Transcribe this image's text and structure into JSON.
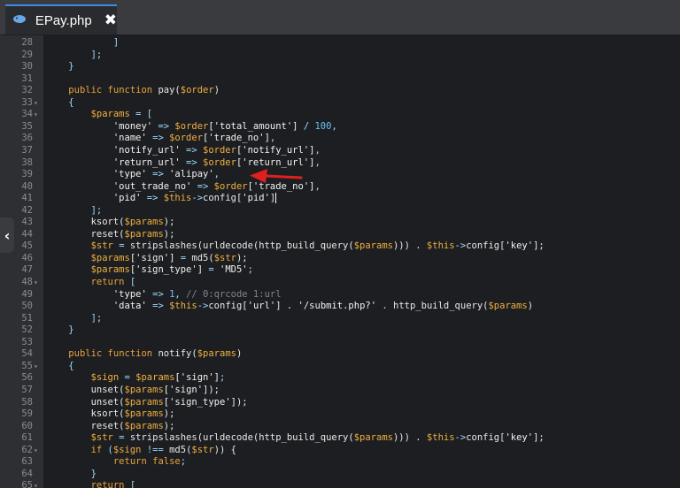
{
  "tab": {
    "title": "EPay.php",
    "icon": "php-elephant-icon",
    "close_glyph": "✖"
  },
  "side_handle": {
    "glyph": "‹"
  },
  "lines": [
    {
      "n": "28",
      "fold": "",
      "code": [
        {
          "t": "            ]",
          "c": "op"
        }
      ]
    },
    {
      "n": "29",
      "fold": "",
      "code": [
        {
          "t": "        ];",
          "c": "op"
        }
      ]
    },
    {
      "n": "30",
      "fold": "",
      "code": [
        {
          "t": "    }",
          "c": "op"
        }
      ]
    },
    {
      "n": "31",
      "fold": "",
      "code": []
    },
    {
      "n": "32",
      "fold": "",
      "code": [
        {
          "t": "    ",
          "c": ""
        },
        {
          "t": "public function ",
          "c": "kw"
        },
        {
          "t": "pay(",
          "c": "fn"
        },
        {
          "t": "$order",
          "c": "var"
        },
        {
          "t": ")",
          "c": "fn"
        }
      ]
    },
    {
      "n": "33",
      "fold": "▾",
      "code": [
        {
          "t": "    {",
          "c": "op"
        }
      ]
    },
    {
      "n": "34",
      "fold": "▾",
      "code": [
        {
          "t": "        ",
          "c": ""
        },
        {
          "t": "$params",
          "c": "var"
        },
        {
          "t": " = [",
          "c": "op"
        }
      ]
    },
    {
      "n": "35",
      "fold": "",
      "code": [
        {
          "t": "            ",
          "c": ""
        },
        {
          "t": "'money'",
          "c": "str"
        },
        {
          "t": " => ",
          "c": "op"
        },
        {
          "t": "$order",
          "c": "var"
        },
        {
          "t": "['total_amount']",
          "c": "str"
        },
        {
          "t": " / ",
          "c": "op"
        },
        {
          "t": "100",
          "c": "num"
        },
        {
          "t": ",",
          "c": "op"
        }
      ]
    },
    {
      "n": "36",
      "fold": "",
      "code": [
        {
          "t": "            ",
          "c": ""
        },
        {
          "t": "'name'",
          "c": "str"
        },
        {
          "t": " => ",
          "c": "op"
        },
        {
          "t": "$order",
          "c": "var"
        },
        {
          "t": "['trade_no']",
          "c": "str"
        },
        {
          "t": ",",
          "c": "op"
        }
      ]
    },
    {
      "n": "37",
      "fold": "",
      "code": [
        {
          "t": "            ",
          "c": ""
        },
        {
          "t": "'notify_url'",
          "c": "str"
        },
        {
          "t": " => ",
          "c": "op"
        },
        {
          "t": "$order",
          "c": "var"
        },
        {
          "t": "['notify_url']",
          "c": "str"
        },
        {
          "t": ",",
          "c": "op"
        }
      ]
    },
    {
      "n": "38",
      "fold": "",
      "code": [
        {
          "t": "            ",
          "c": ""
        },
        {
          "t": "'return_url'",
          "c": "str"
        },
        {
          "t": " => ",
          "c": "op"
        },
        {
          "t": "$order",
          "c": "var"
        },
        {
          "t": "['return_url']",
          "c": "str"
        },
        {
          "t": ",",
          "c": "op"
        }
      ]
    },
    {
      "n": "39",
      "fold": "",
      "code": [
        {
          "t": "            ",
          "c": ""
        },
        {
          "t": "'type'",
          "c": "str"
        },
        {
          "t": " => ",
          "c": "op"
        },
        {
          "t": "'alipay'",
          "c": "str"
        },
        {
          "t": ",",
          "c": "op"
        }
      ]
    },
    {
      "n": "40",
      "fold": "",
      "code": [
        {
          "t": "            ",
          "c": ""
        },
        {
          "t": "'out_trade_no'",
          "c": "str"
        },
        {
          "t": " => ",
          "c": "op"
        },
        {
          "t": "$order",
          "c": "var"
        },
        {
          "t": "['trade_no']",
          "c": "str"
        },
        {
          "t": ",",
          "c": "op"
        }
      ]
    },
    {
      "n": "41",
      "fold": "",
      "code": [
        {
          "t": "            ",
          "c": ""
        },
        {
          "t": "'pid'",
          "c": "str"
        },
        {
          "t": " => ",
          "c": "op"
        },
        {
          "t": "$this",
          "c": "var"
        },
        {
          "t": "->",
          "c": "op"
        },
        {
          "t": "config[",
          "c": "fn"
        },
        {
          "t": "'pid'",
          "c": "str"
        },
        {
          "t": "]",
          "c": "fn"
        }
      ],
      "cursor": true
    },
    {
      "n": "42",
      "fold": "",
      "code": [
        {
          "t": "        ];",
          "c": "op"
        }
      ]
    },
    {
      "n": "43",
      "fold": "",
      "code": [
        {
          "t": "        ",
          "c": ""
        },
        {
          "t": "ksort(",
          "c": "fn"
        },
        {
          "t": "$params",
          "c": "var"
        },
        {
          "t": ");",
          "c": "fn"
        }
      ]
    },
    {
      "n": "44",
      "fold": "",
      "code": [
        {
          "t": "        ",
          "c": ""
        },
        {
          "t": "reset(",
          "c": "fn"
        },
        {
          "t": "$params",
          "c": "var"
        },
        {
          "t": ");",
          "c": "fn"
        }
      ]
    },
    {
      "n": "45",
      "fold": "",
      "code": [
        {
          "t": "        ",
          "c": ""
        },
        {
          "t": "$str",
          "c": "var"
        },
        {
          "t": " = ",
          "c": "op"
        },
        {
          "t": "stripslashes(urldecode(http_build_query(",
          "c": "fn"
        },
        {
          "t": "$params",
          "c": "var"
        },
        {
          "t": "))) . ",
          "c": "fn"
        },
        {
          "t": "$this",
          "c": "var"
        },
        {
          "t": "->",
          "c": "op"
        },
        {
          "t": "config[",
          "c": "fn"
        },
        {
          "t": "'key'",
          "c": "str"
        },
        {
          "t": "];",
          "c": "fn"
        }
      ]
    },
    {
      "n": "46",
      "fold": "",
      "code": [
        {
          "t": "        ",
          "c": ""
        },
        {
          "t": "$params",
          "c": "var"
        },
        {
          "t": "['sign']",
          "c": "str"
        },
        {
          "t": " = ",
          "c": "op"
        },
        {
          "t": "md5(",
          "c": "fn"
        },
        {
          "t": "$str",
          "c": "var"
        },
        {
          "t": ");",
          "c": "fn"
        }
      ]
    },
    {
      "n": "47",
      "fold": "",
      "code": [
        {
          "t": "        ",
          "c": ""
        },
        {
          "t": "$params",
          "c": "var"
        },
        {
          "t": "['sign_type']",
          "c": "str"
        },
        {
          "t": " = ",
          "c": "op"
        },
        {
          "t": "'MD5'",
          "c": "str"
        },
        {
          "t": ";",
          "c": "op"
        }
      ]
    },
    {
      "n": "48",
      "fold": "▾",
      "code": [
        {
          "t": "        ",
          "c": ""
        },
        {
          "t": "return",
          "c": "kw"
        },
        {
          "t": " [",
          "c": "op"
        }
      ]
    },
    {
      "n": "49",
      "fold": "",
      "code": [
        {
          "t": "            ",
          "c": ""
        },
        {
          "t": "'type'",
          "c": "str"
        },
        {
          "t": " => ",
          "c": "op"
        },
        {
          "t": "1",
          "c": "num"
        },
        {
          "t": ", ",
          "c": "op"
        },
        {
          "t": "// 0:qrcode 1:url",
          "c": "cm"
        }
      ]
    },
    {
      "n": "50",
      "fold": "",
      "code": [
        {
          "t": "            ",
          "c": ""
        },
        {
          "t": "'data'",
          "c": "str"
        },
        {
          "t": " => ",
          "c": "op"
        },
        {
          "t": "$this",
          "c": "var"
        },
        {
          "t": "->",
          "c": "op"
        },
        {
          "t": "config[",
          "c": "fn"
        },
        {
          "t": "'url'",
          "c": "str"
        },
        {
          "t": "] . ",
          "c": "fn"
        },
        {
          "t": "'/submit.php?'",
          "c": "str"
        },
        {
          "t": " . ",
          "c": "op"
        },
        {
          "t": "http_build_query(",
          "c": "fn"
        },
        {
          "t": "$params",
          "c": "var"
        },
        {
          "t": ")",
          "c": "fn"
        }
      ]
    },
    {
      "n": "51",
      "fold": "",
      "code": [
        {
          "t": "        ];",
          "c": "op"
        }
      ]
    },
    {
      "n": "52",
      "fold": "",
      "code": [
        {
          "t": "    }",
          "c": "op"
        }
      ]
    },
    {
      "n": "53",
      "fold": "",
      "code": []
    },
    {
      "n": "54",
      "fold": "",
      "code": [
        {
          "t": "    ",
          "c": ""
        },
        {
          "t": "public function ",
          "c": "kw"
        },
        {
          "t": "notify(",
          "c": "fn"
        },
        {
          "t": "$params",
          "c": "var"
        },
        {
          "t": ")",
          "c": "fn"
        }
      ]
    },
    {
      "n": "55",
      "fold": "▾",
      "code": [
        {
          "t": "    {",
          "c": "op"
        }
      ]
    },
    {
      "n": "56",
      "fold": "",
      "code": [
        {
          "t": "        ",
          "c": ""
        },
        {
          "t": "$sign",
          "c": "var"
        },
        {
          "t": " = ",
          "c": "op"
        },
        {
          "t": "$params",
          "c": "var"
        },
        {
          "t": "['sign']",
          "c": "str"
        },
        {
          "t": ";",
          "c": "op"
        }
      ]
    },
    {
      "n": "57",
      "fold": "",
      "code": [
        {
          "t": "        ",
          "c": ""
        },
        {
          "t": "unset(",
          "c": "fn"
        },
        {
          "t": "$params",
          "c": "var"
        },
        {
          "t": "['sign']",
          "c": "str"
        },
        {
          "t": ");",
          "c": "fn"
        }
      ]
    },
    {
      "n": "58",
      "fold": "",
      "code": [
        {
          "t": "        ",
          "c": ""
        },
        {
          "t": "unset(",
          "c": "fn"
        },
        {
          "t": "$params",
          "c": "var"
        },
        {
          "t": "['sign_type']",
          "c": "str"
        },
        {
          "t": ");",
          "c": "fn"
        }
      ]
    },
    {
      "n": "59",
      "fold": "",
      "code": [
        {
          "t": "        ",
          "c": ""
        },
        {
          "t": "ksort(",
          "c": "fn"
        },
        {
          "t": "$params",
          "c": "var"
        },
        {
          "t": ");",
          "c": "fn"
        }
      ]
    },
    {
      "n": "60",
      "fold": "",
      "code": [
        {
          "t": "        ",
          "c": ""
        },
        {
          "t": "reset(",
          "c": "fn"
        },
        {
          "t": "$params",
          "c": "var"
        },
        {
          "t": ");",
          "c": "fn"
        }
      ]
    },
    {
      "n": "61",
      "fold": "",
      "code": [
        {
          "t": "        ",
          "c": ""
        },
        {
          "t": "$str",
          "c": "var"
        },
        {
          "t": " = ",
          "c": "op"
        },
        {
          "t": "stripslashes(urldecode(http_build_query(",
          "c": "fn"
        },
        {
          "t": "$params",
          "c": "var"
        },
        {
          "t": "))) . ",
          "c": "fn"
        },
        {
          "t": "$this",
          "c": "var"
        },
        {
          "t": "->",
          "c": "op"
        },
        {
          "t": "config[",
          "c": "fn"
        },
        {
          "t": "'key'",
          "c": "str"
        },
        {
          "t": "];",
          "c": "fn"
        }
      ]
    },
    {
      "n": "62",
      "fold": "▾",
      "code": [
        {
          "t": "        ",
          "c": ""
        },
        {
          "t": "if",
          "c": "kw"
        },
        {
          "t": " (",
          "c": "op"
        },
        {
          "t": "$sign",
          "c": "var"
        },
        {
          "t": " !== ",
          "c": "op"
        },
        {
          "t": "md5(",
          "c": "fn"
        },
        {
          "t": "$str",
          "c": "var"
        },
        {
          "t": ")) {",
          "c": "fn"
        }
      ]
    },
    {
      "n": "63",
      "fold": "",
      "code": [
        {
          "t": "            ",
          "c": ""
        },
        {
          "t": "return",
          "c": "kw"
        },
        {
          "t": " ",
          "c": ""
        },
        {
          "t": "false",
          "c": "kw"
        },
        {
          "t": ";",
          "c": "op"
        }
      ]
    },
    {
      "n": "64",
      "fold": "",
      "code": [
        {
          "t": "        }",
          "c": "op"
        }
      ]
    },
    {
      "n": "65",
      "fold": "▾",
      "code": [
        {
          "t": "        ",
          "c": ""
        },
        {
          "t": "return",
          "c": "kw"
        },
        {
          "t": " [",
          "c": "op"
        }
      ]
    }
  ]
}
